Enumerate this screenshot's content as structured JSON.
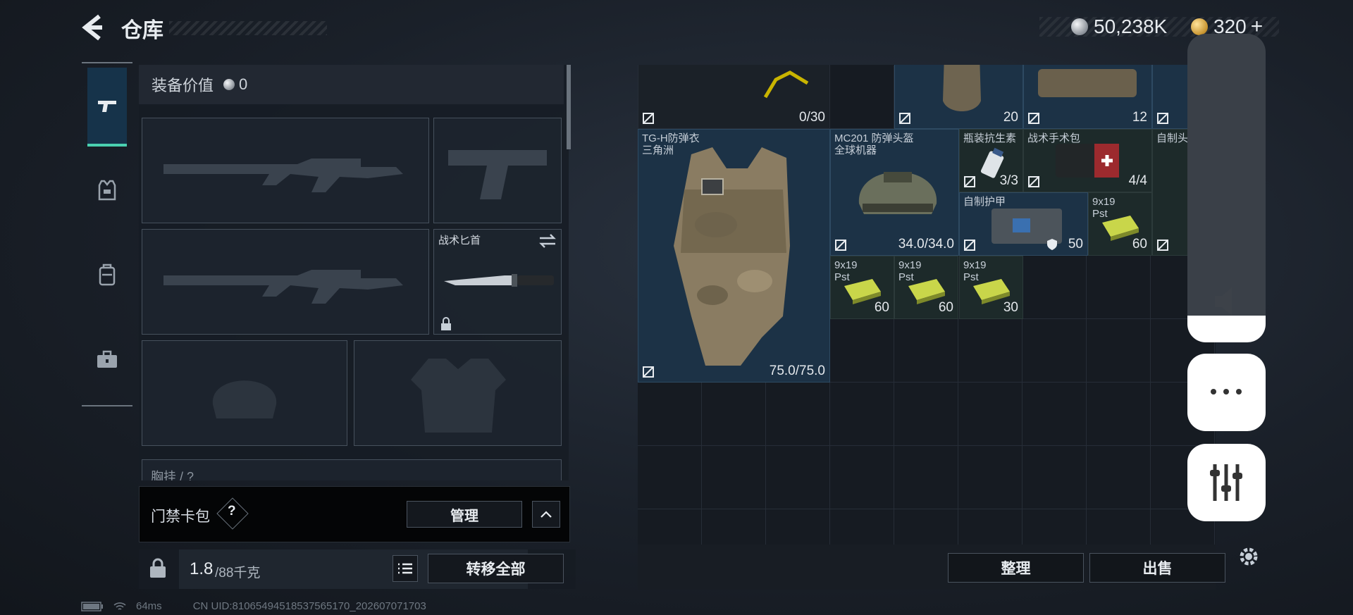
{
  "header": {
    "title": "仓库",
    "currency_silver": "50,238K",
    "currency_gold": "320",
    "plus_symbol": "+"
  },
  "categories": [
    {
      "name": "weapons",
      "icon": "pistol-icon",
      "active": true
    },
    {
      "name": "armor",
      "icon": "armor-vest-icon",
      "active": false
    },
    {
      "name": "backpack",
      "icon": "backpack-icon",
      "active": false
    },
    {
      "name": "toolbox",
      "icon": "toolbox-icon",
      "active": false
    }
  ],
  "equipment": {
    "value_label": "装备价值",
    "value": "0",
    "melee_label": "战术匕首",
    "chest_rig_label": "胸挂 /  ?"
  },
  "keycard": {
    "label": "门禁卡包",
    "help": "?",
    "manage_label": "管理"
  },
  "weight": {
    "current": "1.8",
    "max": "/88千克",
    "transfer_all_label": "转移全部"
  },
  "grid_items": {
    "top_row_vals": [
      "0/30",
      "20",
      "12"
    ],
    "vest": {
      "name_line1": "TG-H防弹衣",
      "name_line2": "三角洲",
      "value": "75.0/75.0"
    },
    "helmet": {
      "name_line1": "MC201 防弹头盔",
      "name_line2": "全球机器",
      "value": "34.0/34.0"
    },
    "antibiotic": {
      "name": "瓶装抗生素",
      "value": "3/3"
    },
    "surgical_kit": {
      "name": "战术手术包",
      "value": "4/4"
    },
    "homemade_head": {
      "name": "自制头"
    },
    "homemade_armor": {
      "name": "自制护甲",
      "value": "50"
    },
    "ammo_1": {
      "name_line1": "9x19",
      "name_line2": "Pst",
      "value": "60"
    },
    "ammo_2": {
      "name_line1": "9x19",
      "name_line2": "Pst",
      "value": "60"
    },
    "ammo_3": {
      "name_line1": "9x19",
      "name_line2": "Pst",
      "value": "60"
    },
    "ammo_4": {
      "name_line1": "9x19",
      "name_line2": "Pst",
      "value": "30"
    }
  },
  "grid_actions": {
    "sort_label": "整理",
    "sell_label": "出售"
  },
  "footer": {
    "ping": "64ms",
    "uid": "CN UID:81065494518537565170_202607071703"
  },
  "colors": {
    "accent_teal": "#4ad0b0",
    "item_blue": "#1c3246"
  }
}
